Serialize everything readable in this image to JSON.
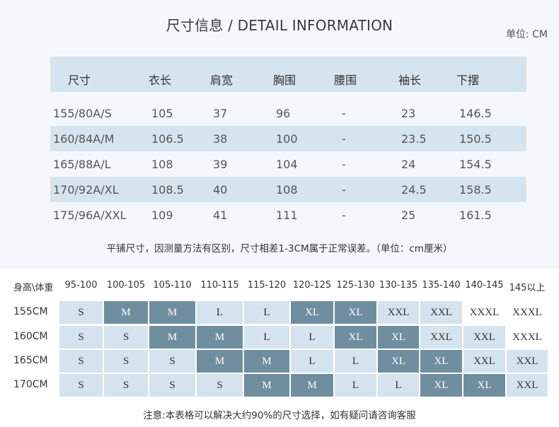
{
  "title": "尺寸信息 / DETAIL INFORMATION",
  "unit": "单位: CM",
  "size_table": {
    "headers": [
      "尺寸",
      "衣长",
      "肩宽",
      "胸围",
      "腰围",
      "袖长",
      "下摆"
    ],
    "rows": [
      [
        "155/80A/S",
        "105",
        "37",
        "96",
        "-",
        "23",
        "146.5"
      ],
      [
        "160/84A/M",
        "106.5",
        "38",
        "100",
        "-",
        "23.5",
        "150.5"
      ],
      [
        "165/88A/L",
        "108",
        "39",
        "104",
        "-",
        "24",
        "154.5"
      ],
      [
        "170/92A/XL",
        "108.5",
        "40",
        "108",
        "-",
        "24.5",
        "158.5"
      ],
      [
        "175/96A/XXL",
        "109",
        "41",
        "111",
        "-",
        "25",
        "161.5"
      ]
    ]
  },
  "note1": "平铺尺寸，因测量方法有区别，尺寸相差1-3CM属于正常误差。（单位：cm厘米）",
  "fit_grid": {
    "corner": "身高\\体重",
    "weights": [
      "95-100",
      "100-105",
      "105-110",
      "110-115",
      "115-120",
      "120-125",
      "125-130",
      "130-135",
      "135-140",
      "140-145",
      "145以上"
    ],
    "rows": [
      {
        "height": "155CM",
        "sizes": [
          "S",
          "M",
          "M",
          "L",
          "L",
          "XL",
          "XL",
          "XXL",
          "XXL",
          "XXXL",
          "XXXL"
        ],
        "shades": [
          "l",
          "d",
          "d",
          "l",
          "l",
          "d",
          "d",
          "l",
          "l",
          "n",
          "n"
        ]
      },
      {
        "height": "160CM",
        "sizes": [
          "S",
          "S",
          "M",
          "M",
          "L",
          "L",
          "XL",
          "XL",
          "XXL",
          "XXL",
          "XXXL"
        ],
        "shades": [
          "l",
          "l",
          "d",
          "d",
          "l",
          "l",
          "d",
          "d",
          "l",
          "l",
          "n"
        ]
      },
      {
        "height": "165CM",
        "sizes": [
          "S",
          "S",
          "S",
          "M",
          "M",
          "L",
          "L",
          "XL",
          "XL",
          "XXL",
          "XXL"
        ],
        "shades": [
          "l",
          "l",
          "l",
          "d",
          "d",
          "l",
          "l",
          "d",
          "d",
          "l",
          "l"
        ]
      },
      {
        "height": "170CM",
        "sizes": [
          "S",
          "S",
          "S",
          "S",
          "M",
          "M",
          "L",
          "L",
          "XL",
          "XL",
          "XXL"
        ],
        "shades": [
          "l",
          "l",
          "l",
          "l",
          "d",
          "d",
          "l",
          "l",
          "d",
          "d",
          "l"
        ]
      }
    ]
  },
  "note2": "注意:本表格可以解决大约90%的尺寸选择，如有疑问请咨询客服",
  "colors": {
    "band": "#d6e4ef",
    "light": "#d5e3ee",
    "dark": "#6f8fa0"
  }
}
